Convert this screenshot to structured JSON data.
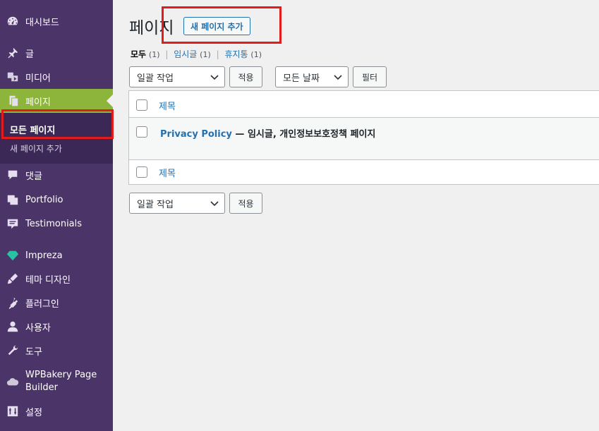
{
  "sidebar": {
    "items": [
      {
        "label": "대시보드",
        "icon": "dashboard-icon"
      },
      {
        "label": "글",
        "icon": "pin-icon"
      },
      {
        "label": "미디어",
        "icon": "media-icon"
      },
      {
        "label": "페이지",
        "icon": "pages-icon"
      },
      {
        "label": "댓글",
        "icon": "comment-icon"
      },
      {
        "label": "Portfolio",
        "icon": "portfolio-icon"
      },
      {
        "label": "Testimonials",
        "icon": "testimonial-icon"
      },
      {
        "label": "Impreza",
        "icon": "diamond-icon"
      },
      {
        "label": "테마 디자인",
        "icon": "brush-icon"
      },
      {
        "label": "플러그인",
        "icon": "plugin-icon"
      },
      {
        "label": "사용자",
        "icon": "user-icon"
      },
      {
        "label": "도구",
        "icon": "wrench-icon"
      },
      {
        "label": "WPBakery Page Builder",
        "icon": "cloud-icon"
      },
      {
        "label": "설정",
        "icon": "settings-icon"
      }
    ],
    "submenu": {
      "all_pages": "모든 페이지",
      "add_new": "새 페이지 추가"
    },
    "accent_color": "#8db43b",
    "bg_color": "#4b3468"
  },
  "main": {
    "title": "페이지",
    "add_new_button": "새 페이지 추가",
    "filters": {
      "all": "모두",
      "all_count": "(1)",
      "draft": "임시글",
      "draft_count": "(1)",
      "trash": "휴지통",
      "trash_count": "(1)",
      "separator": "|"
    },
    "bulk_action": "일괄 작업",
    "apply": "적용",
    "date_filter": "모든 날짜",
    "filter_button": "필터",
    "table": {
      "column_title": "제목",
      "rows": [
        {
          "title": "Privacy Policy",
          "state": " — 임시글, 개인정보보호정책 페이지"
        }
      ]
    },
    "link_color": "#2271b1"
  }
}
